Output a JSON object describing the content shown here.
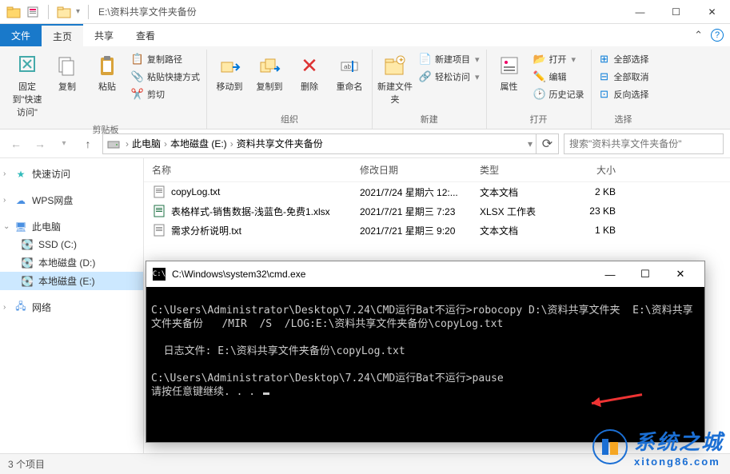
{
  "window": {
    "title": "E:\\资料共享文件夹备份",
    "min": "—",
    "max": "☐",
    "close": "✕"
  },
  "tabs": {
    "file": "文件",
    "home": "主页",
    "share": "共享",
    "view": "查看"
  },
  "ribbon": {
    "pin": {
      "label": "固定到\"快速访问\""
    },
    "copy": {
      "label": "复制"
    },
    "paste": {
      "label": "粘贴"
    },
    "copy_path": "复制路径",
    "paste_shortcut": "粘贴快捷方式",
    "cut": "剪切",
    "group_clipboard": "剪贴板",
    "move_to": "移动到",
    "copy_to": "复制到",
    "delete": "删除",
    "rename": "重命名",
    "group_organize": "组织",
    "new_folder": "新建文件夹",
    "new_item": "新建项目",
    "easy_access": "轻松访问",
    "group_new": "新建",
    "properties": "属性",
    "open": "打开",
    "edit": "编辑",
    "history": "历史记录",
    "group_open": "打开",
    "select_all": "全部选择",
    "select_none": "全部取消",
    "invert_selection": "反向选择",
    "group_select": "选择"
  },
  "breadcrumb": {
    "root": "此电脑",
    "drive": "本地磁盘 (E:)",
    "folder": "资料共享文件夹备份"
  },
  "search_placeholder": "搜索\"资料共享文件夹备份\"",
  "columns": {
    "name": "名称",
    "date": "修改日期",
    "type": "类型",
    "size": "大小"
  },
  "files": [
    {
      "icon": "txt",
      "name": "copyLog.txt",
      "date": "2021/7/24 星期六 12:...",
      "type": "文本文档",
      "size": "2 KB"
    },
    {
      "icon": "xlsx",
      "name": "表格样式-销售数据-浅蓝色-免费1.xlsx",
      "date": "2021/7/21 星期三 7:23",
      "type": "XLSX 工作表",
      "size": "23 KB"
    },
    {
      "icon": "txt",
      "name": "需求分析说明.txt",
      "date": "2021/7/21 星期三 9:20",
      "type": "文本文档",
      "size": "1 KB"
    }
  ],
  "sidebar": {
    "quick": "快速访问",
    "wps": "WPS网盘",
    "thispc": "此电脑",
    "ssd": "SSD (C:)",
    "d": "本地磁盘 (D:)",
    "e": "本地磁盘 (E:)",
    "network": "网络"
  },
  "status": "3 个项目",
  "cmd": {
    "title": "C:\\Windows\\system32\\cmd.exe",
    "lines": [
      "",
      "C:\\Users\\Administrator\\Desktop\\7.24\\CMD运行Bat不运行>robocopy D:\\资料共享文件夹  E:\\资料共享文件夹备份   /MIR  /S  /LOG:E:\\资料共享文件夹备份\\copyLog.txt",
      "",
      "  日志文件: E:\\资料共享文件夹备份\\copyLog.txt",
      "",
      "C:\\Users\\Administrator\\Desktop\\7.24\\CMD运行Bat不运行>pause",
      "请按任意键继续. . . "
    ]
  },
  "watermark": {
    "title": "系统之城",
    "url": "xitong86.com"
  }
}
